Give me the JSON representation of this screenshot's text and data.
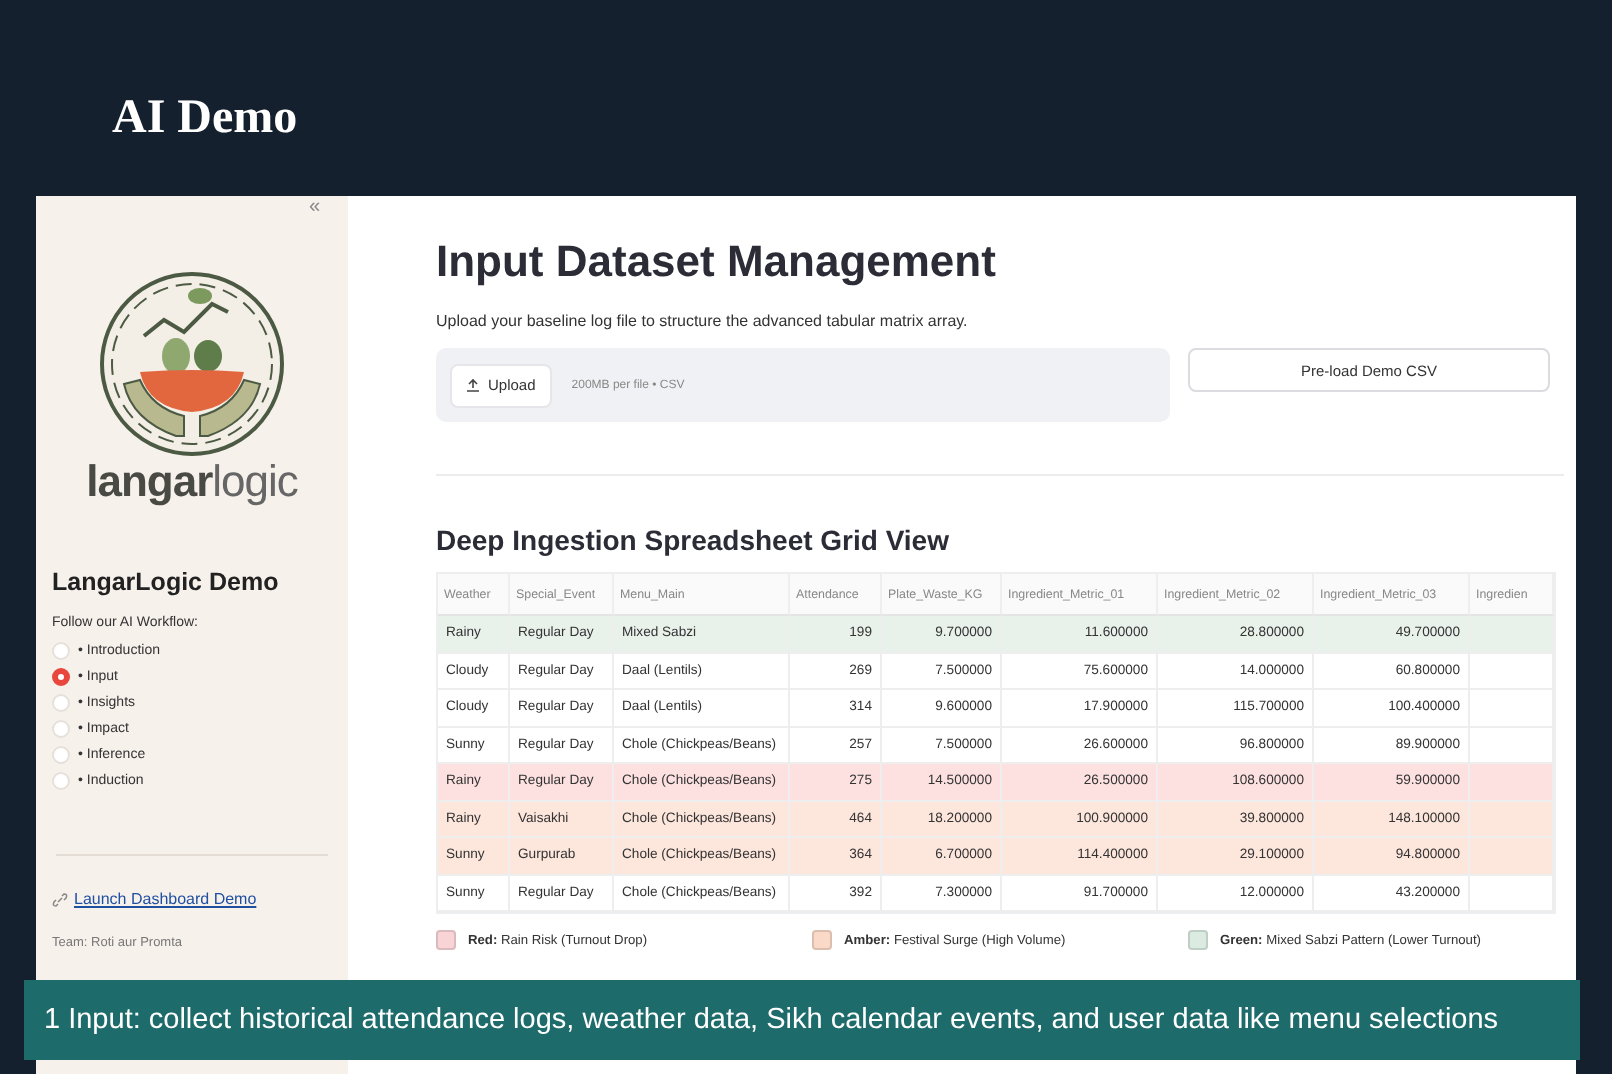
{
  "slide_title": "AI Demo",
  "sidebar": {
    "collapse_glyph": "«",
    "logo": {
      "word_bold": "langar",
      "word_light": "logic"
    },
    "title": "LangarLogic Demo",
    "prompt": "Follow our AI Workflow:",
    "workflow": [
      {
        "label": "• Introduction",
        "selected": false
      },
      {
        "label": "• Input",
        "selected": true
      },
      {
        "label": "• Insights",
        "selected": false
      },
      {
        "label": "• Impact",
        "selected": false
      },
      {
        "label": "• Inference",
        "selected": false
      },
      {
        "label": "• Induction",
        "selected": false
      }
    ],
    "link": "Launch Dashboard Demo",
    "team": "Team: Roti aur Promta"
  },
  "main": {
    "title": "Input Dataset Management",
    "subtitle": "Upload your baseline log file to structure the advanced tabular matrix array.",
    "upload": {
      "button": "Upload",
      "hint": "200MB per file • CSV"
    },
    "preload_button": "Pre-load Demo CSV",
    "section_title": "Deep Ingestion Spreadsheet Grid View",
    "table": {
      "columns": [
        "Weather",
        "Special_Event",
        "Menu_Main",
        "Attendance",
        "Plate_Waste_KG",
        "Ingredient_Metric_01",
        "Ingredient_Metric_02",
        "Ingredient_Metric_03",
        "Ingredien"
      ],
      "rows": [
        {
          "color": "#e9f1eb",
          "cells": [
            "Rainy",
            "Regular Day",
            "Mixed Sabzi",
            "199",
            "9.700000",
            "11.600000",
            "28.800000",
            "49.700000"
          ]
        },
        {
          "color": "#ffffff",
          "cells": [
            "Cloudy",
            "Regular Day",
            "Daal (Lentils)",
            "269",
            "7.500000",
            "75.600000",
            "14.000000",
            "60.800000"
          ]
        },
        {
          "color": "#ffffff",
          "cells": [
            "Cloudy",
            "Regular Day",
            "Daal (Lentils)",
            "314",
            "9.600000",
            "17.900000",
            "115.700000",
            "100.400000"
          ]
        },
        {
          "color": "#ffffff",
          "cells": [
            "Sunny",
            "Regular Day",
            "Chole (Chickpeas/Beans)",
            "257",
            "7.500000",
            "26.600000",
            "96.800000",
            "89.900000"
          ]
        },
        {
          "color": "#fde1e1",
          "cells": [
            "Rainy",
            "Regular Day",
            "Chole (Chickpeas/Beans)",
            "275",
            "14.500000",
            "26.500000",
            "108.600000",
            "59.900000"
          ]
        },
        {
          "color": "#fde6dc",
          "cells": [
            "Rainy",
            "Vaisakhi",
            "Chole (Chickpeas/Beans)",
            "464",
            "18.200000",
            "100.900000",
            "39.800000",
            "148.100000"
          ]
        },
        {
          "color": "#fde6dc",
          "cells": [
            "Sunny",
            "Gurpurab",
            "Chole (Chickpeas/Beans)",
            "364",
            "6.700000",
            "114.400000",
            "29.100000",
            "94.800000"
          ]
        },
        {
          "color": "#ffffff",
          "cells": [
            "Sunny",
            "Regular Day",
            "Chole (Chickpeas/Beans)",
            "392",
            "7.300000",
            "91.700000",
            "12.000000",
            "43.200000"
          ]
        }
      ]
    },
    "legend": [
      {
        "color": "#f9d4d6",
        "label": "Red:",
        "text": "Rain Risk (Turnout Drop)"
      },
      {
        "color": "#fbd9c8",
        "label": "Amber:",
        "text": "Festival Surge (High Volume)"
      },
      {
        "color": "#dcebe2",
        "label": "Green:",
        "text": "Mixed Sabzi Pattern (Lower Turnout)"
      }
    ]
  },
  "caption": "1 Input: collect historical attendance logs, weather data, Sikh calendar events, and user data like menu selections"
}
